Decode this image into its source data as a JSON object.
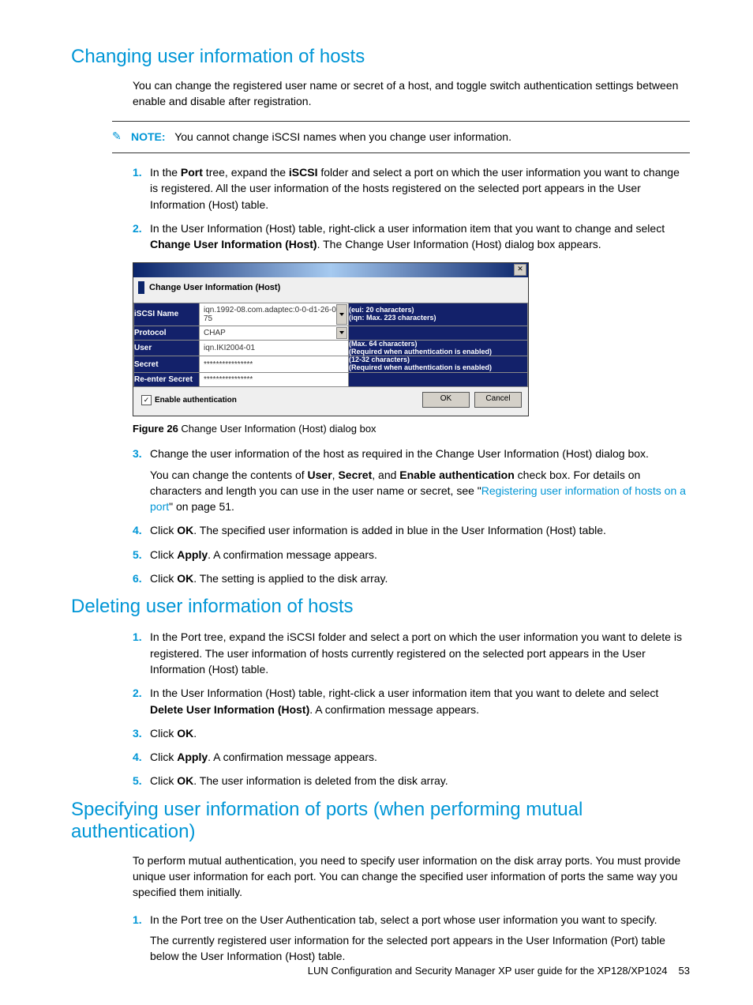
{
  "sections": {
    "changing": {
      "heading": "Changing user information of hosts",
      "intro": "You can change the registered user name or secret of a host, and toggle switch authentication settings between enable and disable after registration.",
      "note_label": "NOTE:",
      "note_text": "You cannot change iSCSI names when you change user information.",
      "steps": {
        "s1_a": "In the ",
        "s1_b": "Port",
        "s1_c": " tree, expand the ",
        "s1_d": "iSCSI",
        "s1_e": " folder and select a port on which the user information you want to change is registered. All the user information of the hosts registered on the selected port appears in the User Information (Host) table.",
        "s2_a": "In the User Information (Host) table, right-click a user information item that you want to change and select ",
        "s2_b": "Change User Information (Host)",
        "s2_c": ". The Change User Information (Host) dialog box appears.",
        "s3": "Change the user information of the host as required in the Change User Information (Host) dialog box.",
        "s3_sub_a": "You can change the contents of ",
        "s3_sub_b": "User",
        "s3_sub_c": ", ",
        "s3_sub_d": "Secret",
        "s3_sub_e": ", and ",
        "s3_sub_f": "Enable authentication",
        "s3_sub_g": " check box. For details on characters and length you can use in the user name or secret, see \"",
        "s3_link": "Registering user information of hosts on a port",
        "s3_sub_h": "\" on page 51.",
        "s4_a": "Click ",
        "s4_b": "OK",
        "s4_c": ". The specified user information is added in blue in the User Information (Host) table.",
        "s5_a": "Click ",
        "s5_b": "Apply",
        "s5_c": ". A confirmation message appears.",
        "s6_a": "Click ",
        "s6_b": "OK",
        "s6_c": ". The setting is applied to the disk array."
      },
      "figure": {
        "label": "Figure 26",
        "caption": "Change User Information (Host) dialog box"
      }
    },
    "deleting": {
      "heading": "Deleting user information of hosts",
      "steps": {
        "s1": "In the Port tree, expand the iSCSI folder and select a port on which the user information you want to delete is registered. The user information of hosts currently registered on the selected port appears in the User Information (Host) table.",
        "s2_a": "In the User Information (Host) table, right-click a user information item that you want to delete and select ",
        "s2_b": "Delete User Information (Host)",
        "s2_c": ". A confirmation message appears.",
        "s3_a": "Click ",
        "s3_b": "OK",
        "s3_c": ".",
        "s4_a": "Click ",
        "s4_b": "Apply",
        "s4_c": ". A confirmation message appears.",
        "s5_a": "Click ",
        "s5_b": "OK",
        "s5_c": ". The user information is deleted from the disk array."
      }
    },
    "specifying": {
      "heading": "Specifying user information of ports (when performing mutual authentication)",
      "intro": "To perform mutual authentication, you need to specify user information on the disk array ports. You must provide unique user information for each port. You can change the specified user information of ports the same way you specified them initially.",
      "steps": {
        "s1": "In the Port tree on the User Authentication tab, select a port whose user information you want to specify.",
        "s1_sub": "The currently registered user information for the selected port appears in the User Information (Port) table below the User Information (Host) table."
      }
    }
  },
  "dialog": {
    "title": "Change User Information (Host)",
    "rows": {
      "iscsi": {
        "label": "iSCSI Name",
        "value": "iqn.1992-08.com.adaptec:0-0-d1-26-0-75",
        "hint1": "(eui: 20 characters)",
        "hint2": "(iqn: Max. 223 characters)"
      },
      "protocol": {
        "label": "Protocol",
        "value": "CHAP"
      },
      "user": {
        "label": "User",
        "value": "iqn.IKI2004-01",
        "hint1": "(Max. 64 characters)",
        "hint2": "(Required when authentication is enabled)"
      },
      "secret": {
        "label": "Secret",
        "value": "****************",
        "hint1": "(12-32 characters)",
        "hint2": "(Required when authentication is enabled)"
      },
      "reenter": {
        "label": "Re-enter Secret",
        "value": "****************"
      }
    },
    "checkbox": "Enable authentication",
    "ok": "OK",
    "cancel": "Cancel"
  },
  "footer": {
    "text": "LUN Configuration and Security Manager XP user guide for the XP128/XP1024",
    "page": "53"
  }
}
